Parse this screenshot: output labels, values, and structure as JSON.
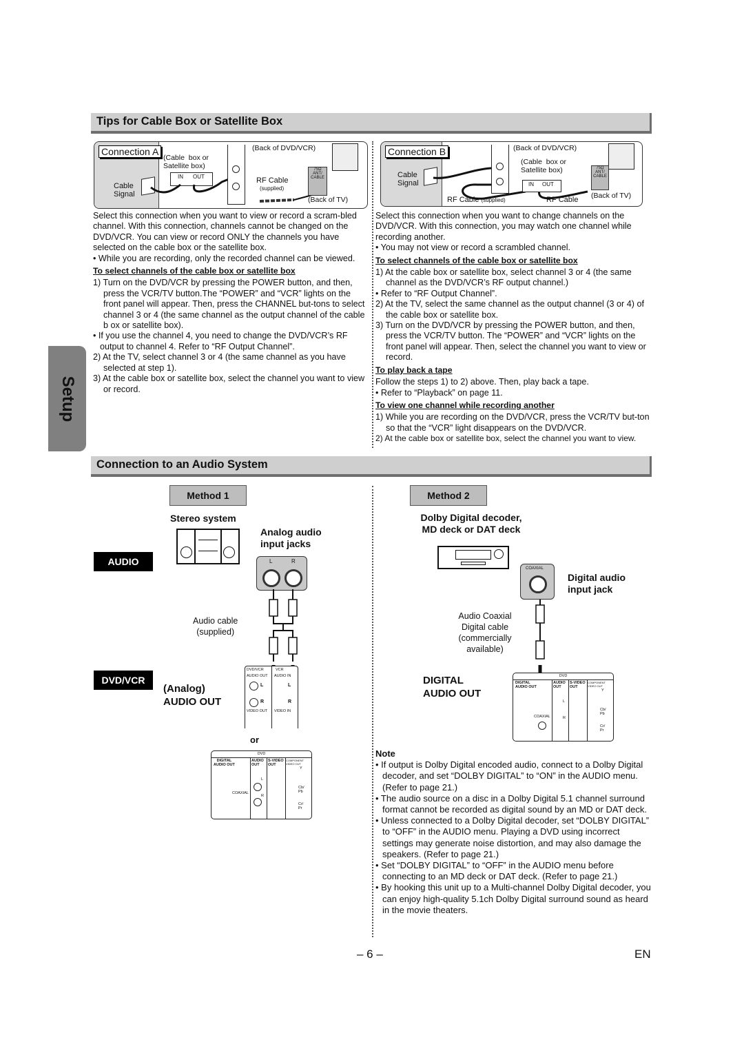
{
  "side_tab": {
    "label": "Setup"
  },
  "section1": {
    "title": "Tips for Cable Box or Satellite Box",
    "connection_a": {
      "label": "Connection A",
      "diagram": {
        "cable_signal": "Cable\nSignal",
        "cable_box": "(Cable  box or\nSatellite box)",
        "in": "IN",
        "out": "OUT",
        "back_dvd": "(Back of DVD/VCR)",
        "rf_cable": "RF Cable",
        "supplied": "(supplied)",
        "tv_jack": "75Ω ANT/ CABLE",
        "back_tv": "(Back of TV)"
      },
      "intro": "Select this connection when you want to view or record a scram-bled channel. With this connection, channels cannot be changed on the DVD/VCR. You can view or record ONLY the channels you have selected on the cable box or the satellite box.",
      "bullet1": "• While you are recording, only the recorded channel can be viewed.",
      "subhead": "To select channels of the cable box or satellite box",
      "step1": "1) Turn on the DVD/VCR by pressing the POWER button, and then, press the VCR/TV button.The “POWER” and “VCR” lights on the front panel will appear. Then, press the CHANNEL but-tons to select channel 3 or 4 (the same channel as the output channel of the cable b ox or satellite box).",
      "bullet2": "• If you use the channel 4, you need to change the DVD/VCR’s RF output to channel 4. Refer to “RF Output Channel”.",
      "step2": "2) At the TV, select channel 3 or 4 (the same channel as you have selected at step 1).",
      "step3": "3) At the cable box or satellite box, select the channel you want to view or record."
    },
    "connection_b": {
      "label": "Connection B",
      "diagram": {
        "cable_signal": "Cable\nSignal",
        "back_dvd": "(Back of DVD/VCR)",
        "cable_box": "(Cable  box or\nSatellite box)",
        "in": "IN",
        "out": "OUT",
        "rf_cable_supplied": "RF Cable",
        "supplied": "(supplied)",
        "rf_cable": "RF Cable",
        "tv_jack": "75Ω ANT/ CABLE",
        "back_tv": "(Back of TV)"
      },
      "intro": "Select this connection when you want to change channels on the DVD/VCR. With this connection, you may watch one channel while recording another.",
      "bullet1": "• You may not view or record a scrambled channel.",
      "subhead1": "To select channels of the cable box or satellite box",
      "step1": "1) At the cable box or satellite box, select channel 3 or 4 (the same channel as the DVD/VCR’s RF output channel.)",
      "bullet2": "• Refer to “RF Output Channel”.",
      "step2": "2) At the TV, select the same channel as the output channel (3 or 4) of the cable box or satellite box.",
      "step3": "3) Turn on the DVD/VCR by pressing the POWER button, and then, press the VCR/TV button. The “POWER” and “VCR” lights on the front panel will appear. Then, select the channel you want to view or record.",
      "subhead2": "To play back a tape",
      "playback_text": "Follow the steps 1) to 2) above. Then, play back a tape.",
      "playback_bullet": "• Refer to “Playback” on page 11.",
      "subhead3": "To view one channel while recording another",
      "view_step1": "1) While you are recording on the DVD/VCR, press the VCR/TV but-ton so that the “VCR” light disappears on the DVD/VCR.",
      "view_step2": "2) At the cable box or satellite box, select the channel you want to view."
    }
  },
  "section2": {
    "title": "Connection to an Audio System",
    "audio_tag": "AUDIO",
    "dvdvcr_tag": "DVD/VCR",
    "method1": {
      "label": "Method 1",
      "stereo": "Stereo system",
      "analog_jacks": "Analog audio\ninput jacks",
      "jack_l": "L",
      "jack_r": "R",
      "cable": "Audio cable\n(supplied)",
      "analog_out": "(Analog)\nAUDIO OUT",
      "panel": {
        "dvdvcr": "DVD/VCR",
        "vcr": "VCR",
        "audio_out": "AUDIO OUT",
        "audio_in": "AUDIO IN",
        "l": "L",
        "r": "R",
        "video_out": "VIDEO OUT",
        "video_in": "VIDEO IN"
      },
      "or": "or",
      "dvd_panel": {
        "dvd": "DVD",
        "digital_audio_out": "DIGITAL\nAUDIO OUT",
        "audio_out": "AUDIO\nOUT",
        "svideo_out": "S-VIDEO\nOUT",
        "component": "COMPONENT\nVIDEO OUT",
        "coaxial": "COAXIAL",
        "l": "L",
        "r": "R",
        "y": "Y",
        "cb": "Cb/\nPb",
        "cr": "Cr/\nPr"
      }
    },
    "method2": {
      "label": "Method 2",
      "device": "Dolby Digital decoder,\nMD deck or DAT deck",
      "coaxial_tag": "COAXIAL",
      "digital_jack": "Digital audio\ninput jack",
      "cable": "Audio Coaxial\nDigital cable\n(commercially\navailable)",
      "digital_out": "DIGITAL\nAUDIO OUT",
      "note_title": "Note",
      "notes": [
        "• If output is Dolby Digital encoded audio, connect to a Dolby Digital decoder, and set “DOLBY DIGITAL” to “ON” in the AUDIO menu. (Refer to page 21.)",
        "• The audio source on a disc in a Dolby Digital 5.1 channel surround format cannot be recorded as digital sound by an MD or DAT deck.",
        "• Unless connected to a Dolby Digital decoder, set “DOLBY DIGITAL” to “OFF” in the AUDIO menu. Playing a DVD using incorrect settings may generate noise distortion, and may also damage the speakers. (Refer to page 21.)",
        "• Set “DOLBY DIGITAL” to “OFF” in the AUDIO menu before connecting to an MD deck or DAT deck. (Refer to page 21.)",
        "• By hooking this unit up to a Multi-channel Dolby Digital decoder, you can enjoy high-quality 5.1ch Dolby Digital surround sound as heard in the movie theaters."
      ]
    }
  },
  "footer": {
    "page": "– 6 –",
    "lang": "EN"
  }
}
